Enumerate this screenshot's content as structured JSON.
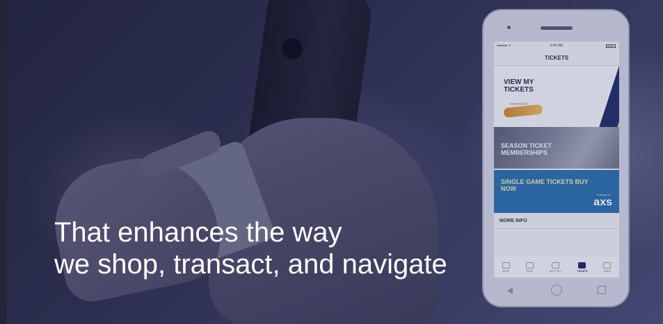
{
  "headline": {
    "line1": "That enhances the way",
    "line2": "we shop, transact, and navigate"
  },
  "phone": {
    "status_time": "9:41 AM",
    "status_carrier": "●●●●● ᯤ",
    "nav_title": "TICKETS",
    "tiles": [
      {
        "id": "view",
        "title": "VIEW MY TICKETS",
        "logo_caption": "POWERED BY"
      },
      {
        "id": "season",
        "title": "SEASON TICKET MEMBERSHIPS"
      },
      {
        "id": "single",
        "title": "SINGLE GAME TICKETS BUY NOW",
        "powered": "POWERED BY",
        "brand": "axs"
      }
    ],
    "more_info": "MORE INFO",
    "tabs": [
      "NEWS",
      "TEAM",
      "MATCHES",
      "TICKETS",
      "MORE"
    ],
    "active_tab": "TICKETS"
  },
  "colors": {
    "overlay": "#141c3c",
    "headline_text": "#ffffff",
    "single_tile": "#2c6fa8",
    "stripe_navy": "#1f2f66",
    "stripe_gold": "#e5c64a"
  }
}
